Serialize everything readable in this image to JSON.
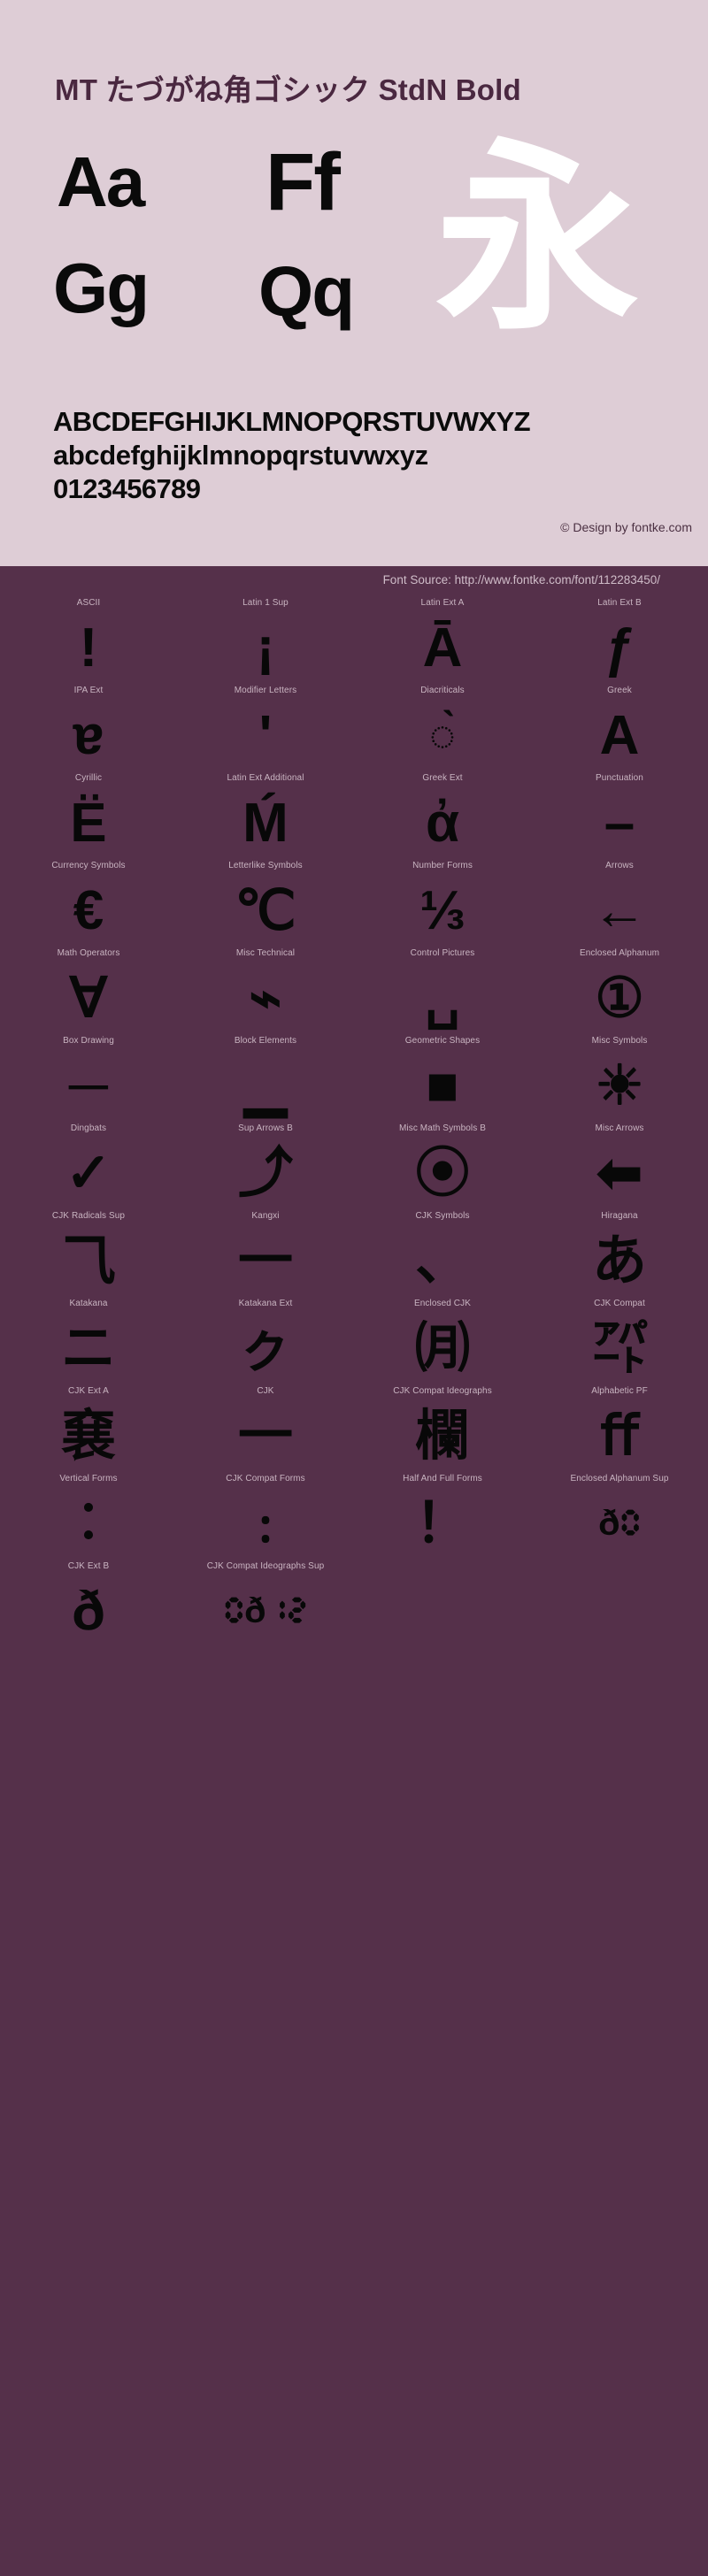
{
  "header": {
    "title": "MT たづがね角ゴシック StdN Bold",
    "samples": {
      "aa": "Aa",
      "ff": "Ff",
      "gg": "Gg",
      "qq": "Qq",
      "cjk": "永"
    },
    "alphabet_upper": "ABCDEFGHIJKLMNOPQRSTUVWXYZ",
    "alphabet_lower": "abcdefghijklmnopqrstuvwxyz",
    "digits": "0123456789",
    "design_credit": "© Design by fontke.com",
    "font_source": "Font Source: http://www.fontke.com/font/112283450/"
  },
  "colors": {
    "header_background": "#decdd6",
    "body_background": "#55304a",
    "title_text": "#4a2840",
    "glyph_black": "#080808",
    "glyph_white": "#ffffff",
    "label_text": "#c9b4c1"
  },
  "blocks": [
    {
      "label": "ASCII",
      "glyph": "!"
    },
    {
      "label": "Latin 1 Sup",
      "glyph": "¡"
    },
    {
      "label": "Latin Ext A",
      "glyph": "Ā"
    },
    {
      "label": "Latin Ext B",
      "glyph": "ƒ"
    },
    {
      "label": "IPA Ext",
      "glyph": "ɐ"
    },
    {
      "label": "Modifier Letters",
      "glyph": "ʹ"
    },
    {
      "label": "Diacriticals",
      "glyph": "◌̀"
    },
    {
      "label": "Greek",
      "glyph": "Α"
    },
    {
      "label": "Cyrillic",
      "glyph": "Ё"
    },
    {
      "label": "Latin Ext Additional",
      "glyph": "Ḿ"
    },
    {
      "label": "Greek Ext",
      "glyph": "ἀ"
    },
    {
      "label": "Punctuation",
      "glyph": "–"
    },
    {
      "label": "Currency Symbols",
      "glyph": "€"
    },
    {
      "label": "Letterlike Symbols",
      "glyph": "℃"
    },
    {
      "label": "Number Forms",
      "glyph": "⅓"
    },
    {
      "label": "Arrows",
      "glyph": "←"
    },
    {
      "label": "Math Operators",
      "glyph": "∀"
    },
    {
      "label": "Misc Technical",
      "glyph": "⌁"
    },
    {
      "label": "Control Pictures",
      "glyph": "␣"
    },
    {
      "label": "Enclosed Alphanum",
      "glyph": "①"
    },
    {
      "label": "Box Drawing",
      "glyph": "─"
    },
    {
      "label": "Block Elements",
      "glyph": "▁"
    },
    {
      "label": "Geometric Shapes",
      "glyph": "■"
    },
    {
      "label": "Misc Symbols",
      "glyph": "☀"
    },
    {
      "label": "Dingbats",
      "glyph": "✓"
    },
    {
      "label": "Sup Arrows B",
      "glyph": "⤴"
    },
    {
      "label": "Misc Math Symbols B",
      "glyph": "⦿"
    },
    {
      "label": "Misc Arrows",
      "glyph": "⬅"
    },
    {
      "label": "CJK Radicals Sup",
      "glyph": "⺄"
    },
    {
      "label": "Kangxi",
      "glyph": "⼀"
    },
    {
      "label": "CJK Symbols",
      "glyph": "、"
    },
    {
      "label": "Hiragana",
      "glyph": "あ"
    },
    {
      "label": "Katakana",
      "glyph": "ニ"
    },
    {
      "label": "Katakana Ext",
      "glyph": "ㇰ"
    },
    {
      "label": "Enclosed CJK",
      "glyph": "㈪"
    },
    {
      "label": "CJK Compat",
      "glyph": "㌀"
    },
    {
      "label": "CJK Ext A",
      "glyph": "㐮"
    },
    {
      "label": "CJK",
      "glyph": "一"
    },
    {
      "label": "CJK Compat Ideographs",
      "glyph": "欄"
    },
    {
      "label": "Alphabetic PF",
      "glyph": "ﬀ"
    },
    {
      "label": "Vertical Forms",
      "glyph": "︰"
    },
    {
      "label": "CJK Compat Forms",
      "glyph": "﹕"
    },
    {
      "label": "Half And Full Forms",
      "glyph": "！"
    },
    {
      "label": "Enclosed Alphanum Sup",
      "glyph": "ð🯰"
    },
    {
      "label": "CJK Ext B",
      "glyph": "ð"
    },
    {
      "label": "CJK Compat Ideographs Sup",
      "glyph": "🯰ð🯱🯲"
    },
    {
      "label": "",
      "glyph": ""
    },
    {
      "label": "",
      "glyph": ""
    }
  ]
}
